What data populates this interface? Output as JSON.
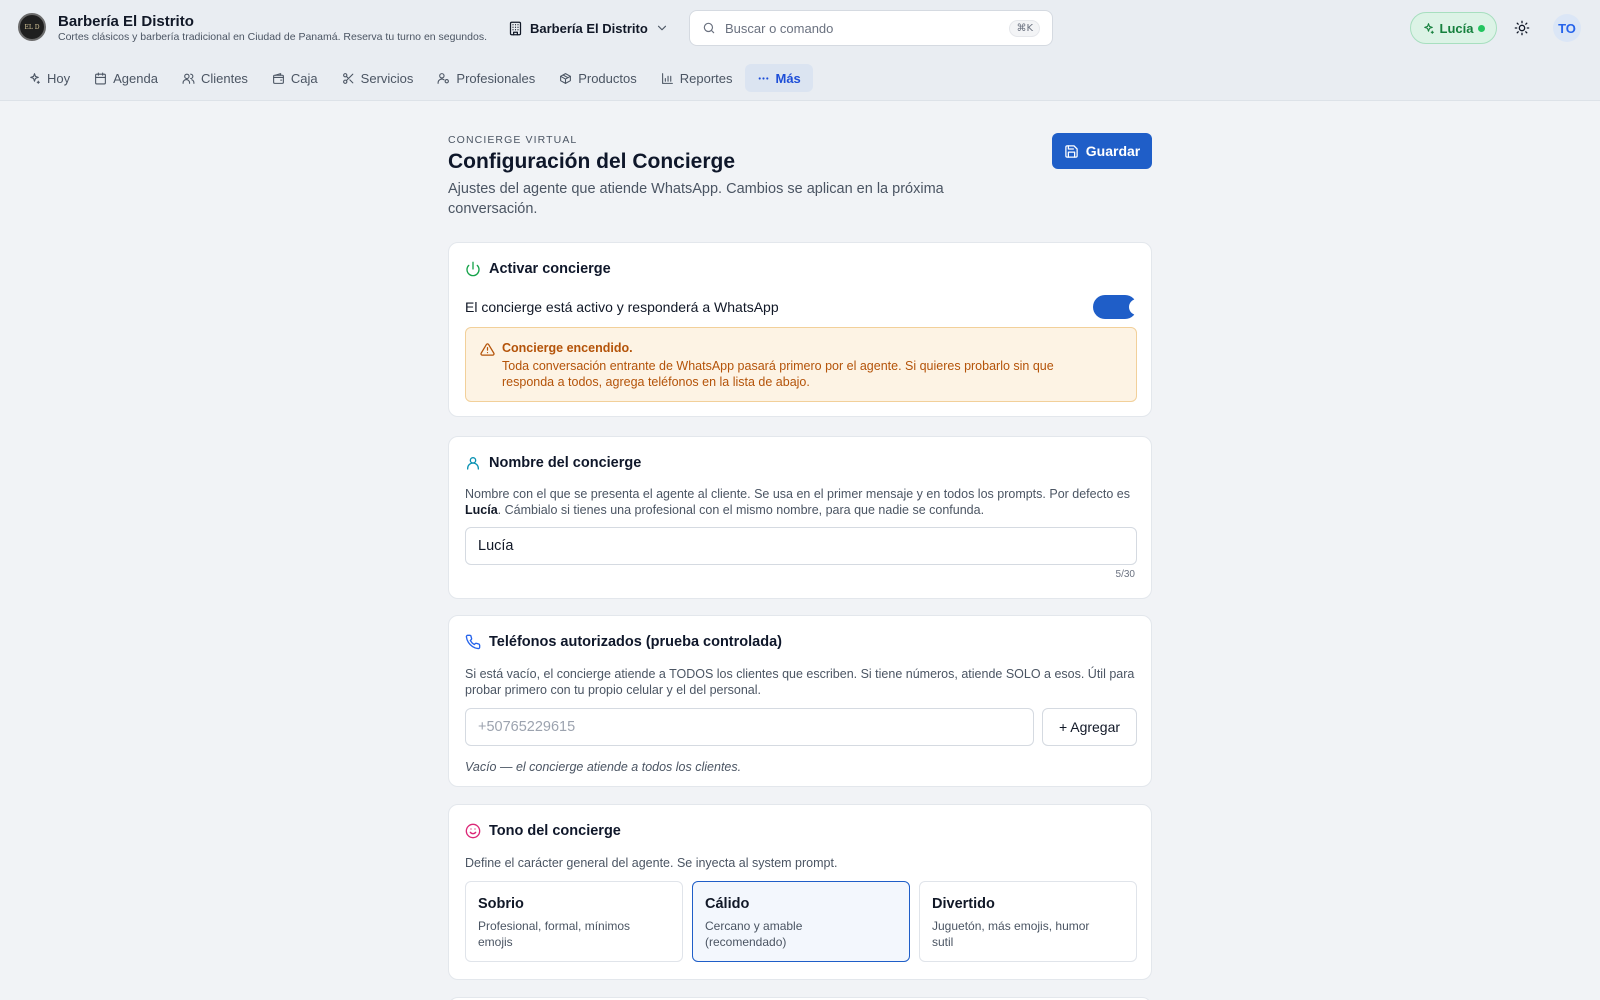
{
  "header": {
    "brand_name": "Barbería El Distrito",
    "brand_subtitle": "Cortes clásicos y barbería tradicional en Ciudad de Panamá. Reserva tu turno en segundos.",
    "branch": "Barbería El Distrito",
    "search_placeholder": "Buscar o comando",
    "search_shortcut": "⌘K",
    "agent_name": "Lucía",
    "avatar_initials": "TO"
  },
  "nav": {
    "items": [
      {
        "label": "Hoy",
        "icon": "sparkles-icon"
      },
      {
        "label": "Agenda",
        "icon": "calendar-icon"
      },
      {
        "label": "Clientes",
        "icon": "users-icon"
      },
      {
        "label": "Caja",
        "icon": "wallet-icon"
      },
      {
        "label": "Servicios",
        "icon": "scissors-icon"
      },
      {
        "label": "Profesionales",
        "icon": "user-cog-icon"
      },
      {
        "label": "Productos",
        "icon": "package-icon"
      },
      {
        "label": "Reportes",
        "icon": "bar-chart-icon"
      },
      {
        "label": "Más",
        "icon": "more-icon",
        "active": true
      }
    ]
  },
  "page": {
    "eyebrow": "CONCIERGE VIRTUAL",
    "title": "Configuración del Concierge",
    "description": "Ajustes del agente que atiende WhatsApp. Cambios se aplican en la próxima conversación.",
    "save_label": "Guardar"
  },
  "activate": {
    "title": "Activar concierge",
    "status_text": "El concierge está activo y responderá a WhatsApp",
    "enabled": true,
    "alert_title": "Concierge encendido.",
    "alert_body": "Toda conversación entrante de WhatsApp pasará primero por el agente. Si quieres probarlo sin que responda a todos, agrega teléfonos en la lista de abajo."
  },
  "name_card": {
    "title": "Nombre del concierge",
    "desc_before": "Nombre con el que se presenta el agente al cliente. Se usa en el primer mensaje y en todos los prompts. Por defecto es ",
    "desc_bold": "Lucía",
    "desc_after": ". Cámbialo si tienes una profesional con el mismo nombre, para que nadie se confunda.",
    "value": "Lucía",
    "counter": "5/30"
  },
  "phones_card": {
    "title": "Teléfonos autorizados (prueba controlada)",
    "description": "Si está vacío, el concierge atiende a TODOS los clientes que escriben. Si tiene números, atiende SOLO a esos. Útil para probar primero con tu propio celular y el del personal.",
    "placeholder": "+50765229615",
    "add_label": "+ Agregar",
    "empty_note": "Vacío — el concierge atiende a todos los clientes."
  },
  "tone_card": {
    "title": "Tono del concierge",
    "description": "Define el carácter general del agente. Se inyecta al system prompt.",
    "options": [
      {
        "title": "Sobrio",
        "desc": "Profesional, formal, mínimos emojis"
      },
      {
        "title": "Cálido",
        "desc": "Cercano y amable (recomendado)",
        "selected": true
      },
      {
        "title": "Divertido",
        "desc": "Juguetón, más emojis, humor sutil"
      }
    ]
  },
  "colors": {
    "primary": "#1f5ec8",
    "success": "#22c55e",
    "warning_bg": "#fdf3e4",
    "warning_text": "#b45309"
  }
}
